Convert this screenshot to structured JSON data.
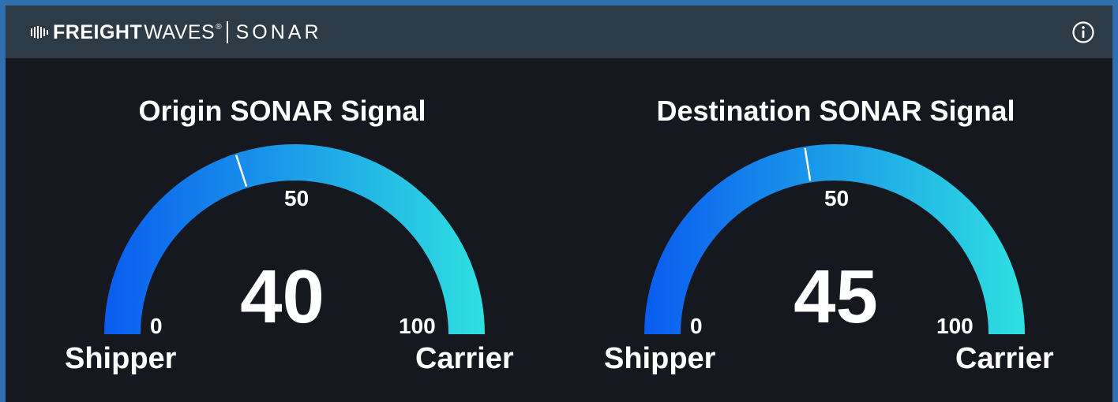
{
  "header": {
    "brand_bold": "FREIGHT",
    "brand_light": "WAVES",
    "brand_tm": "®",
    "brand_product": "SONAR",
    "info_icon": "info-circle-icon"
  },
  "colors": {
    "background": "#15191f",
    "header": "#2c3b46",
    "border": "#2f6fb0",
    "gauge_start": "#0a5cf0",
    "gauge_end": "#2ee0e0",
    "needle": "#ffffff"
  },
  "gauges": [
    {
      "title": "Origin SONAR Signal",
      "value": 40,
      "value_label": "40",
      "min_label": "0",
      "mid_label": "50",
      "max_label": "100",
      "left_label": "Shipper",
      "right_label": "Carrier"
    },
    {
      "title": "Destination SONAR Signal",
      "value": 45,
      "value_label": "45",
      "min_label": "0",
      "mid_label": "50",
      "max_label": "100",
      "left_label": "Shipper",
      "right_label": "Carrier"
    }
  ]
}
